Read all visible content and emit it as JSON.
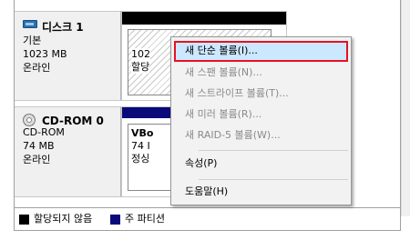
{
  "disks": {
    "disk1": {
      "name": "디스크 1",
      "type": "기본",
      "size": "1023 MB",
      "status": "온라인",
      "partition_size_partial": "102",
      "partition_status_partial": "할당"
    },
    "cdrom": {
      "name": "CD-ROM 0",
      "type": "CD-ROM",
      "size": "74 MB",
      "status": "온라인",
      "volume_label_partial": "VBo",
      "volume_size_partial": "74 I",
      "volume_status_partial": "정싱"
    }
  },
  "context_menu": {
    "items": [
      {
        "label": "새 단순 볼륨(I)...",
        "state": "highlighted"
      },
      {
        "label": "새 스팬 볼륨(N)...",
        "state": "disabled"
      },
      {
        "label": "새 스트라이프 볼륨(T)...",
        "state": "disabled"
      },
      {
        "label": "새 미러 볼륨(R)...",
        "state": "disabled"
      },
      {
        "label": "새 RAID-5 볼륨(W)...",
        "state": "disabled"
      },
      {
        "label": "속성(P)",
        "state": "enabled"
      },
      {
        "label": "도움말(H)",
        "state": "enabled"
      }
    ]
  },
  "legend": {
    "unallocated": "할당되지 않음",
    "primary_partition": "주 파티션"
  },
  "colors": {
    "unallocated": "#000000",
    "primary_partition": "#0a0a7a",
    "menu_highlight": "#cce8ff",
    "highlight_border": "#e81123"
  }
}
